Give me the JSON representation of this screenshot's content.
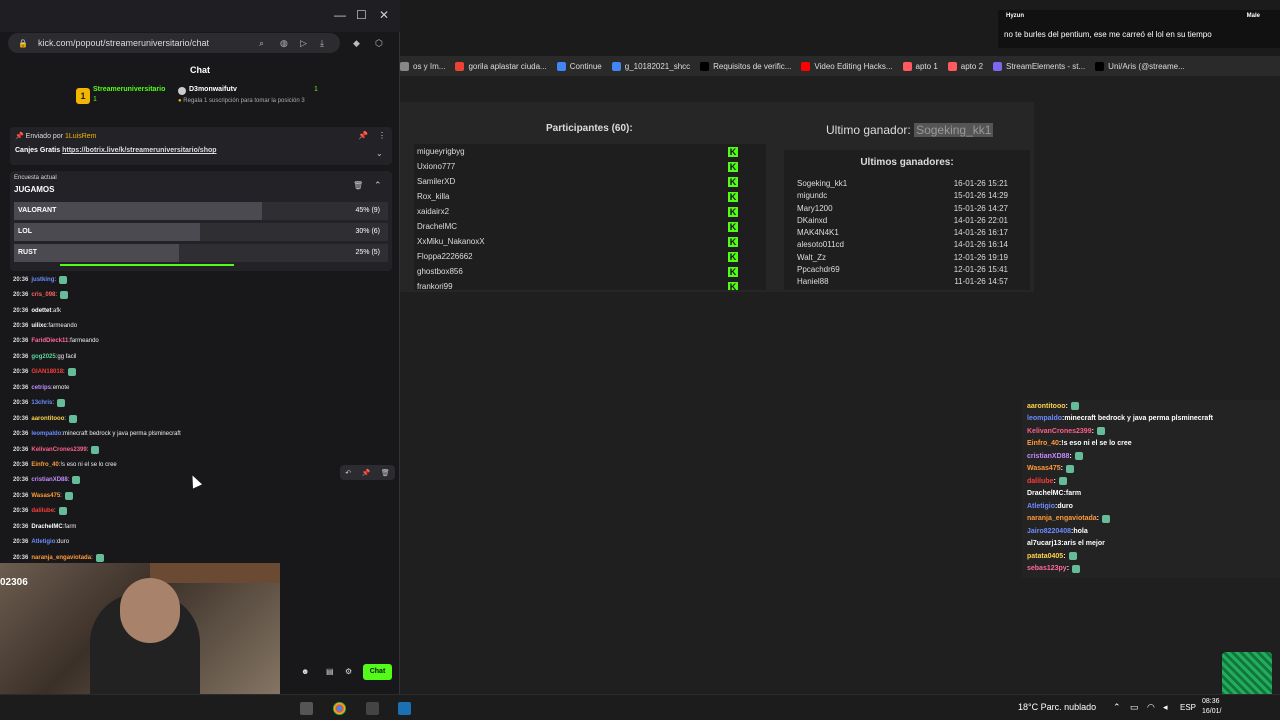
{
  "browser": {
    "bookmarks": [
      {
        "label": "os y Im...",
        "color": "#888"
      },
      {
        "label": "gorila aplastar ciuda...",
        "color": "#ea4335"
      },
      {
        "label": "Continue",
        "color": "#4285f4"
      },
      {
        "label": "g_10182021_shcc",
        "color": "#4285f4"
      },
      {
        "label": "Requisitos de verific...",
        "color": "#000"
      },
      {
        "label": "Video Editing Hacks...",
        "color": "#ff0000"
      },
      {
        "label": "apto 1",
        "color": "#ff5a5f"
      },
      {
        "label": "apto 2",
        "color": "#ff5a5f"
      },
      {
        "label": "StreamElements - st...",
        "color": "#7b68ee"
      },
      {
        "label": "Uni/Aris (@streame...",
        "color": "#000"
      }
    ]
  },
  "popup": {
    "url": "kick.com/popout/streameruniversitario/chat",
    "chat_header": "Chat",
    "leaders": [
      {
        "name": "Streameruniversitario",
        "count": "1"
      },
      {
        "name": "D3monwaifutv",
        "count": "1",
        "sub": "Regala 1 suscripción para tomar la posición 3"
      }
    ],
    "pinned": {
      "sent_by_label": "Enviado por",
      "sent_by_user": "1LuisRem",
      "prefix": "Canjes Gratis",
      "link": "https://botrix.live/k/streameruniversitario/shop"
    },
    "poll": {
      "label": "Encuesta actual",
      "title": "JUGAMOS",
      "options": [
        {
          "name": "VALORANT",
          "value": "45% (9)",
          "pct": 45
        },
        {
          "name": "LOL",
          "value": "30% (6)",
          "pct": 30
        },
        {
          "name": "RUST",
          "value": "25% (5)",
          "pct": 25
        }
      ]
    },
    "chat": [
      {
        "time": "20:36",
        "user": "justking",
        "color": "#6b8cff",
        "msg": ""
      },
      {
        "time": "20:36",
        "user": "cris_098",
        "color": "#ff5f5f",
        "msg": ""
      },
      {
        "time": "20:36",
        "user": "odettet",
        "color": "#ffffff",
        "msg": "afk"
      },
      {
        "time": "20:36",
        "user": "uilixc",
        "color": "#ffffff",
        "msg": "farmeando"
      },
      {
        "time": "20:36",
        "user": "FaridDieck11",
        "color": "#ff6a9a",
        "msg": "farmeando"
      },
      {
        "time": "20:36",
        "user": "gog2025",
        "color": "#5fd39b",
        "msg": "gg facil"
      },
      {
        "time": "20:36",
        "user": "GIAN18018",
        "color": "#ff3b3b",
        "msg": ""
      },
      {
        "time": "20:36",
        "user": "cetrips",
        "color": "#c28cff",
        "msg": "emote"
      },
      {
        "time": "20:36",
        "user": "13chris",
        "color": "#6b8cff",
        "msg": ""
      },
      {
        "time": "20:36",
        "user": "aarontitooo",
        "color": "#ffd24a",
        "msg": ""
      },
      {
        "time": "20:36",
        "user": "leompaldo",
        "color": "#6b8cff",
        "msg": "minecraft bedrock y java perma plsminecraft"
      },
      {
        "time": "20:36",
        "user": "KelivanCrones2399",
        "color": "#ff5f8a",
        "msg": ""
      },
      {
        "time": "20:36",
        "user": "Einfro_40",
        "color": "#ff9a3b",
        "msg": "!s eso ni el se lo cree"
      },
      {
        "time": "20:36",
        "user": "cristianXD88",
        "color": "#c28cff",
        "msg": ""
      },
      {
        "time": "20:36",
        "user": "Wasas475",
        "color": "#ff9a3b",
        "msg": ""
      },
      {
        "time": "20:36",
        "user": "dalilube",
        "color": "#ff3b3b",
        "msg": ""
      },
      {
        "time": "20:36",
        "user": "DrachelMC",
        "color": "#ffffff",
        "msg": "farm"
      },
      {
        "time": "20:36",
        "user": "Atletigio",
        "color": "#6b8cff",
        "msg": "duro"
      },
      {
        "time": "20:36",
        "user": "naranja_engaviotada",
        "color": "#ff9a3b",
        "msg": ""
      }
    ],
    "chat_button": "Chat",
    "webcam_text": "02306"
  },
  "participants": {
    "title": "Participantes",
    "count": "(60):",
    "list": [
      "migueyrigbyg",
      "Uxiono777",
      "SamilerXD",
      "Rox_killa",
      "xaidairx2",
      "DrachelMC",
      "XxMiku_NakanoxX",
      "Floppa2226662",
      "ghostbox856",
      "frankori99"
    ]
  },
  "winners": {
    "last_label": "Ultimo ganador:",
    "last_name": "Sogeking_kk1",
    "list_title": "Ultimos ganadores:",
    "list": [
      {
        "name": "Sogeking_kk1",
        "date": "16-01-26 15:21"
      },
      {
        "name": "migundc",
        "date": "15-01-26 14:29"
      },
      {
        "name": "Mary1200",
        "date": "15-01-26 14:27"
      },
      {
        "name": "DKainxd",
        "date": "14-01-26 22:01"
      },
      {
        "name": "MAK4N4K1",
        "date": "14-01-26 16:17"
      },
      {
        "name": "alesoto011cd",
        "date": "14-01-26 16:14"
      },
      {
        "name": "Walt_Zz",
        "date": "12-01-26 19:19"
      },
      {
        "name": "Ppcachdr69",
        "date": "12-01-26 15:41"
      },
      {
        "name": "Haniel88",
        "date": "11-01-26 14:57"
      }
    ]
  },
  "overlay_chat": [
    {
      "user": "aarontitooo",
      "color": "#ffd24a",
      "msg": ""
    },
    {
      "user": "leompaldo",
      "color": "#6b8cff",
      "msg": "minecraft bedrock y java perma plsminecraft"
    },
    {
      "user": "KelivanCrones2399",
      "color": "#ff5f8a",
      "msg": ""
    },
    {
      "user": "Einfro_40",
      "color": "#ff9a3b",
      "msg": "!s eso ni el se lo cree"
    },
    {
      "user": "cristianXD88",
      "color": "#c28cff",
      "msg": ""
    },
    {
      "user": "Wasas475",
      "color": "#ff9a3b",
      "msg": ""
    },
    {
      "user": "dalilube",
      "color": "#ff3b3b",
      "msg": ""
    },
    {
      "user": "DrachelMC",
      "color": "#ffffff",
      "msg": "farm"
    },
    {
      "user": "Atletigio",
      "color": "#6b8cff",
      "msg": "duro"
    },
    {
      "user": "naranja_engaviotada",
      "color": "#ff9a3b",
      "msg": ""
    },
    {
      "user": "Jairo8220408",
      "color": "#6b8cff",
      "msg": "hola"
    },
    {
      "user": "al7ucarj13",
      "color": "#ffffff",
      "msg": "aris el mejor"
    },
    {
      "user": "patata0405",
      "color": "#ffd24a",
      "msg": ""
    },
    {
      "user": "sebas123py",
      "color": "#ff6a9a",
      "msg": ""
    }
  ],
  "notification": {
    "user": "Hyzun",
    "status": "Male",
    "message": "no te burles del pentium, ese me carreó el lol en su tiempo"
  },
  "taskbar": {
    "weather": "18°C  Parc. nublado",
    "lang": "ESP",
    "time": "08:36",
    "date": "16/01/"
  }
}
